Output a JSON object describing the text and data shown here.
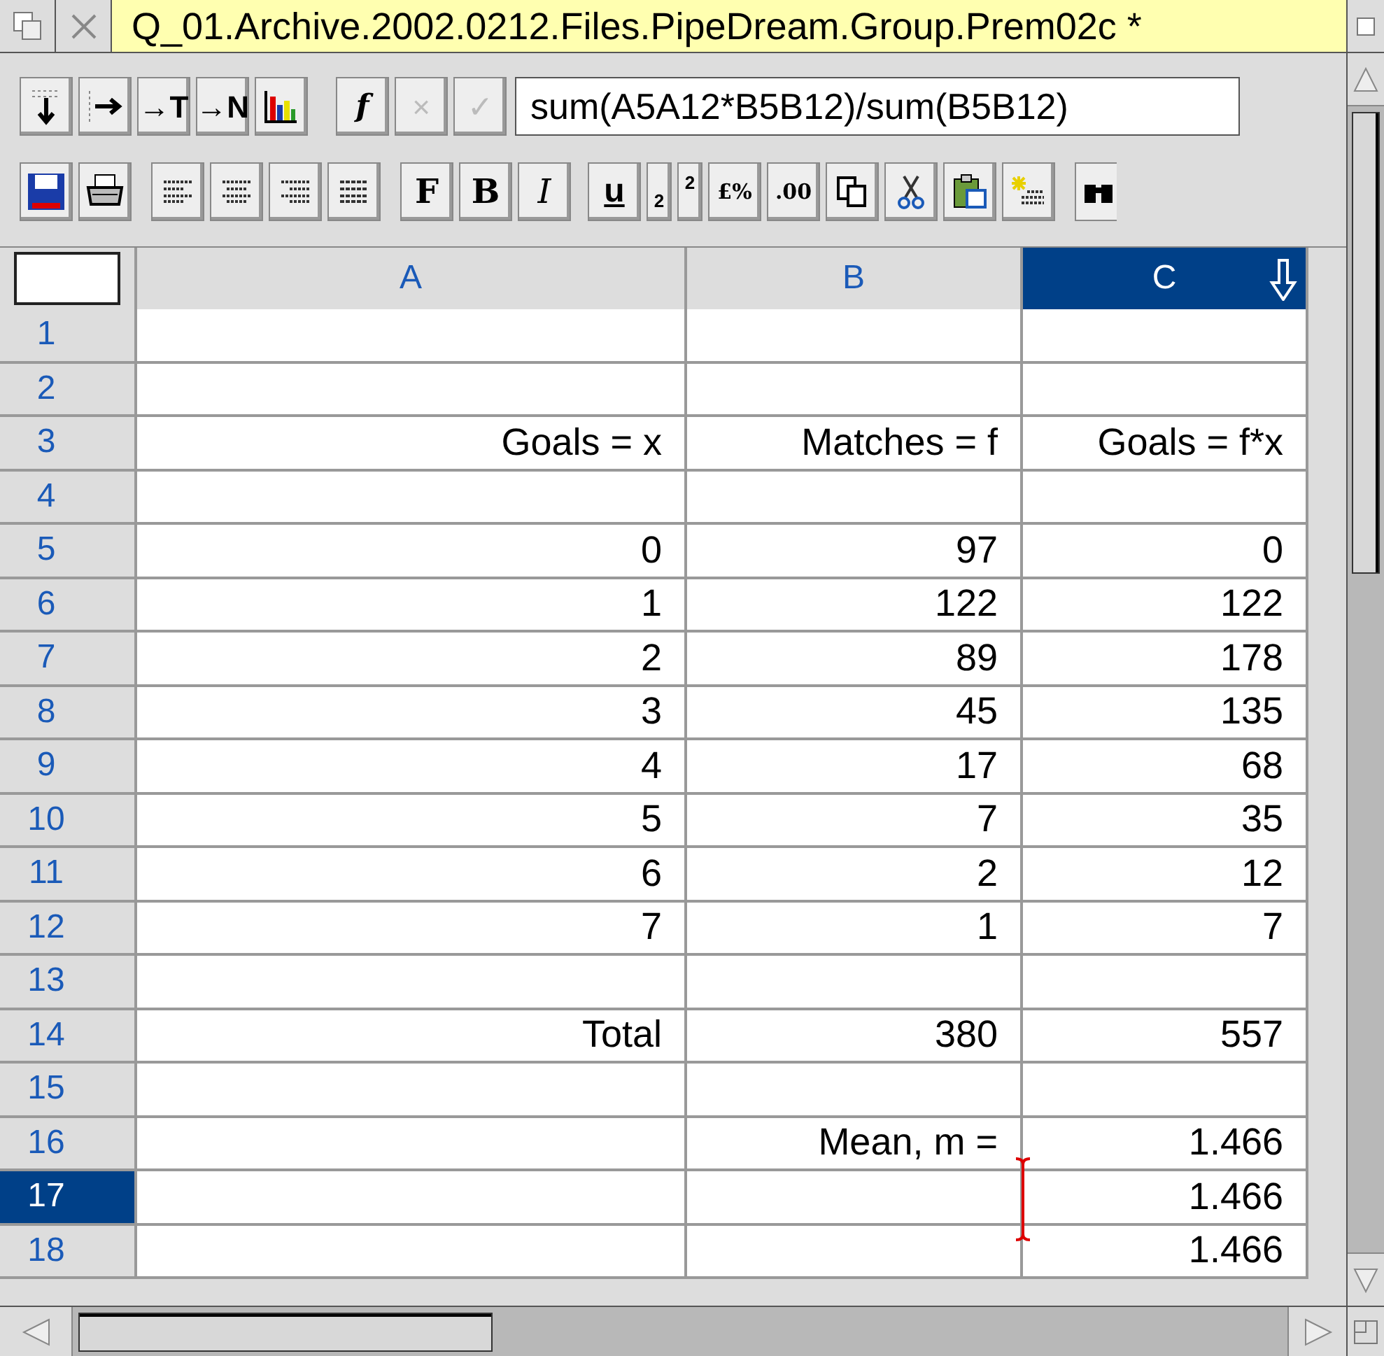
{
  "window": {
    "title": "Q_01.Archive.2002.0212.Files.PipeDream.Group.Prem02c *"
  },
  "toolbar_1": {
    "text_buttons": [
      {
        "label": "→T"
      },
      {
        "label": "→N"
      },
      {
        "label": "f"
      },
      {
        "label": "×",
        "disabled": true
      },
      {
        "label": "✓",
        "disabled": true
      }
    ],
    "formula": "sum(A5A12*B5B12)/sum(B5B12)"
  },
  "toolbar_2": {
    "text_buttons": [
      {
        "label": "F"
      },
      {
        "label": "B"
      },
      {
        "label": "I"
      },
      {
        "label": "u"
      },
      {
        "label": "2",
        "kind": "sub"
      },
      {
        "label": "2",
        "kind": "sup"
      },
      {
        "label": "£%"
      },
      {
        "label": ".00"
      }
    ]
  },
  "columns": [
    {
      "label": "A",
      "selected": false
    },
    {
      "label": "B",
      "selected": false
    },
    {
      "label": "C",
      "selected": true
    }
  ],
  "rows": [
    {
      "number": "1",
      "selected": false,
      "cells": []
    },
    {
      "number": "2",
      "selected": false,
      "cells": []
    },
    {
      "number": "3",
      "selected": false,
      "cells": [
        "Goals = x",
        "Matches = f",
        "Goals = f*x"
      ]
    },
    {
      "number": "4",
      "selected": false,
      "cells": []
    },
    {
      "number": "5",
      "selected": false,
      "cells": [
        "0",
        "97",
        "0"
      ]
    },
    {
      "number": "6",
      "selected": false,
      "cells": [
        "1",
        "122",
        "122"
      ]
    },
    {
      "number": "7",
      "selected": false,
      "cells": [
        "2",
        "89",
        "178"
      ]
    },
    {
      "number": "8",
      "selected": false,
      "cells": [
        "3",
        "45",
        "135"
      ]
    },
    {
      "number": "9",
      "selected": false,
      "cells": [
        "4",
        "17",
        "68"
      ]
    },
    {
      "number": "10",
      "selected": false,
      "cells": [
        "5",
        "7",
        "35"
      ]
    },
    {
      "number": "11",
      "selected": false,
      "cells": [
        "6",
        "2",
        "12"
      ]
    },
    {
      "number": "12",
      "selected": false,
      "cells": [
        "7",
        "1",
        "7"
      ]
    },
    {
      "number": "13",
      "selected": false,
      "cells": []
    },
    {
      "number": "14",
      "selected": false,
      "cells": [
        "Total",
        "380",
        "557"
      ]
    },
    {
      "number": "15",
      "selected": false,
      "cells": []
    },
    {
      "number": "16",
      "selected": false,
      "cells": [
        null,
        "Mean, m =",
        "1.466"
      ]
    },
    {
      "number": "17",
      "selected": true,
      "cells": [
        null,
        null,
        "1.466"
      ]
    },
    {
      "number": "18",
      "selected": false,
      "cells": [
        null,
        null,
        "1.466"
      ]
    }
  ]
}
